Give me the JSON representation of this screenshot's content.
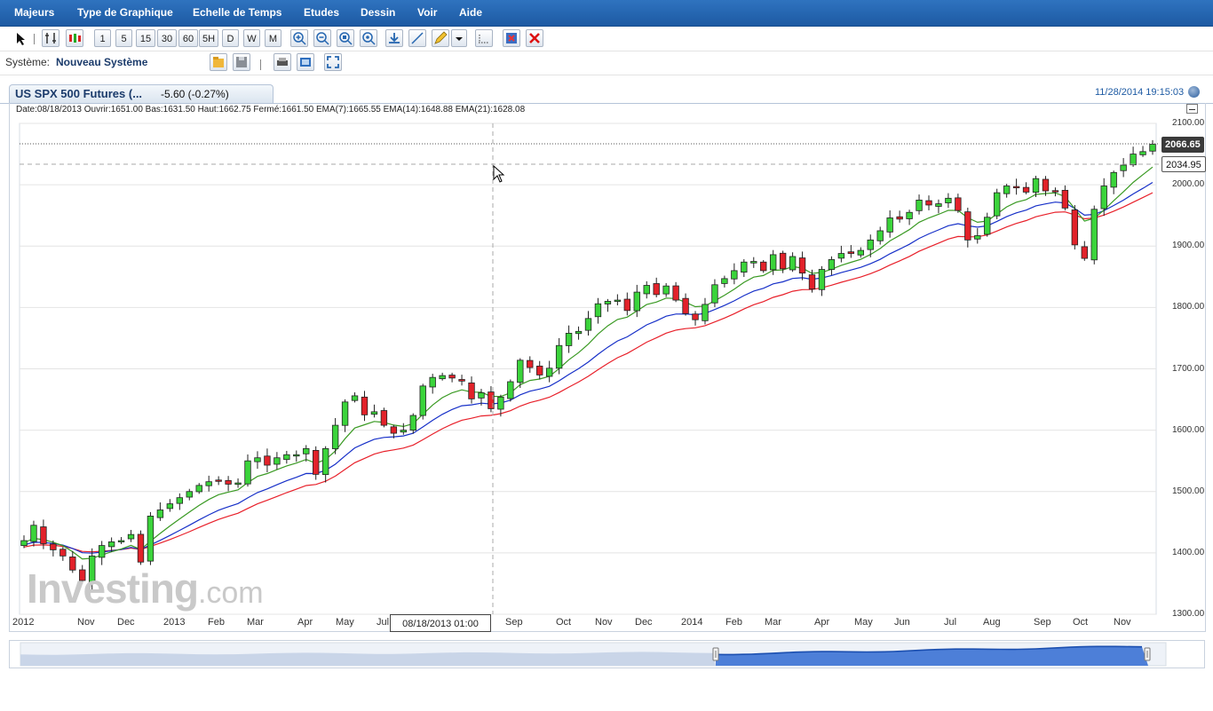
{
  "menu": [
    "Majeurs",
    "Type de Graphique",
    "Echelle de Temps",
    "Etudes",
    "Dessin",
    "Voir",
    "Aide"
  ],
  "toolbar": {
    "timeframes": [
      "1",
      "5",
      "15",
      "30",
      "60",
      "5H",
      "D",
      "W",
      "M"
    ],
    "icons": [
      "pointer-icon",
      "crosshair-icon",
      "candlestick-icon",
      "zoom-in-icon",
      "zoom-out-icon",
      "zoom-area-icon",
      "zoom-reset-icon",
      "download-icon",
      "line-draw-icon",
      "pencil-icon",
      "dropdown-icon",
      "grid-icon",
      "delete-drawing-icon",
      "delete-all-icon"
    ]
  },
  "system": {
    "label": "Système:",
    "name": "Nouveau Système"
  },
  "instrument": {
    "tab_label": "US SPX 500 Futures (...",
    "change": "-5.60 (-0.27%)",
    "timestamp": "11/28/2014 19:15:03"
  },
  "info": {
    "text": "Date:08/18/2013 Ouvrir:1651.00 Bas:1631.50 Haut:1662.75 Fermé:1661.50 EMA(7):1665.55 EMA(14):1648.88 EMA(21):1628.08"
  },
  "chart_data": {
    "type": "candlestick",
    "title": "US SPX 500 Futures",
    "ylim": [
      1300,
      2100
    ],
    "yticks": [
      "2100.00",
      "2000.00",
      "1900.00",
      "1800.00",
      "1700.00",
      "1600.00",
      "1500.00",
      "1400.00",
      "1300.00"
    ],
    "xticks": [
      "2012",
      "Nov",
      "Dec",
      "2013",
      "Feb",
      "Mar",
      "Apr",
      "May",
      "Jul",
      "Sep",
      "Oct",
      "Nov",
      "Dec",
      "2014",
      "Feb",
      "Mar",
      "Apr",
      "May",
      "Jun",
      "Jul",
      "Aug",
      "Sep",
      "Oct",
      "Nov"
    ],
    "crosshair_date": "08/18/2013 01:00",
    "last_price": "2066.65",
    "crosshair_price": "2034.95",
    "closes": [
      1420,
      1445,
      1415,
      1405,
      1395,
      1372,
      1355,
      1395,
      1412,
      1418,
      1420,
      1430,
      1385,
      1460,
      1470,
      1480,
      1490,
      1500,
      1510,
      1516,
      1518,
      1512,
      1514,
      1550,
      1555,
      1543,
      1555,
      1560,
      1560,
      1570,
      1528,
      1570,
      1608,
      1646,
      1656,
      1625,
      1630,
      1608,
      1595,
      1600,
      1624,
      1672,
      1686,
      1689,
      1685,
      1680,
      1651,
      1661,
      1635,
      1654,
      1679,
      1714,
      1702,
      1690,
      1701,
      1738,
      1758,
      1761,
      1782,
      1806,
      1810,
      1812,
      1795,
      1825,
      1836,
      1821,
      1835,
      1812,
      1790,
      1780,
      1805,
      1837,
      1847,
      1860,
      1874,
      1875,
      1860,
      1886,
      1863,
      1883,
      1856,
      1830,
      1862,
      1878,
      1888,
      1888,
      1893,
      1910,
      1925,
      1946,
      1944,
      1955,
      1975,
      1967,
      1969,
      1978,
      1958,
      1910,
      1917,
      1947,
      1987,
      1998,
      1995,
      1988,
      2010,
      1990,
      1990,
      1962,
      1902,
      1880,
      1960,
      1998,
      2020,
      2032,
      2050,
      2054,
      2066
    ]
  },
  "navigator": {
    "label": "navigator"
  }
}
